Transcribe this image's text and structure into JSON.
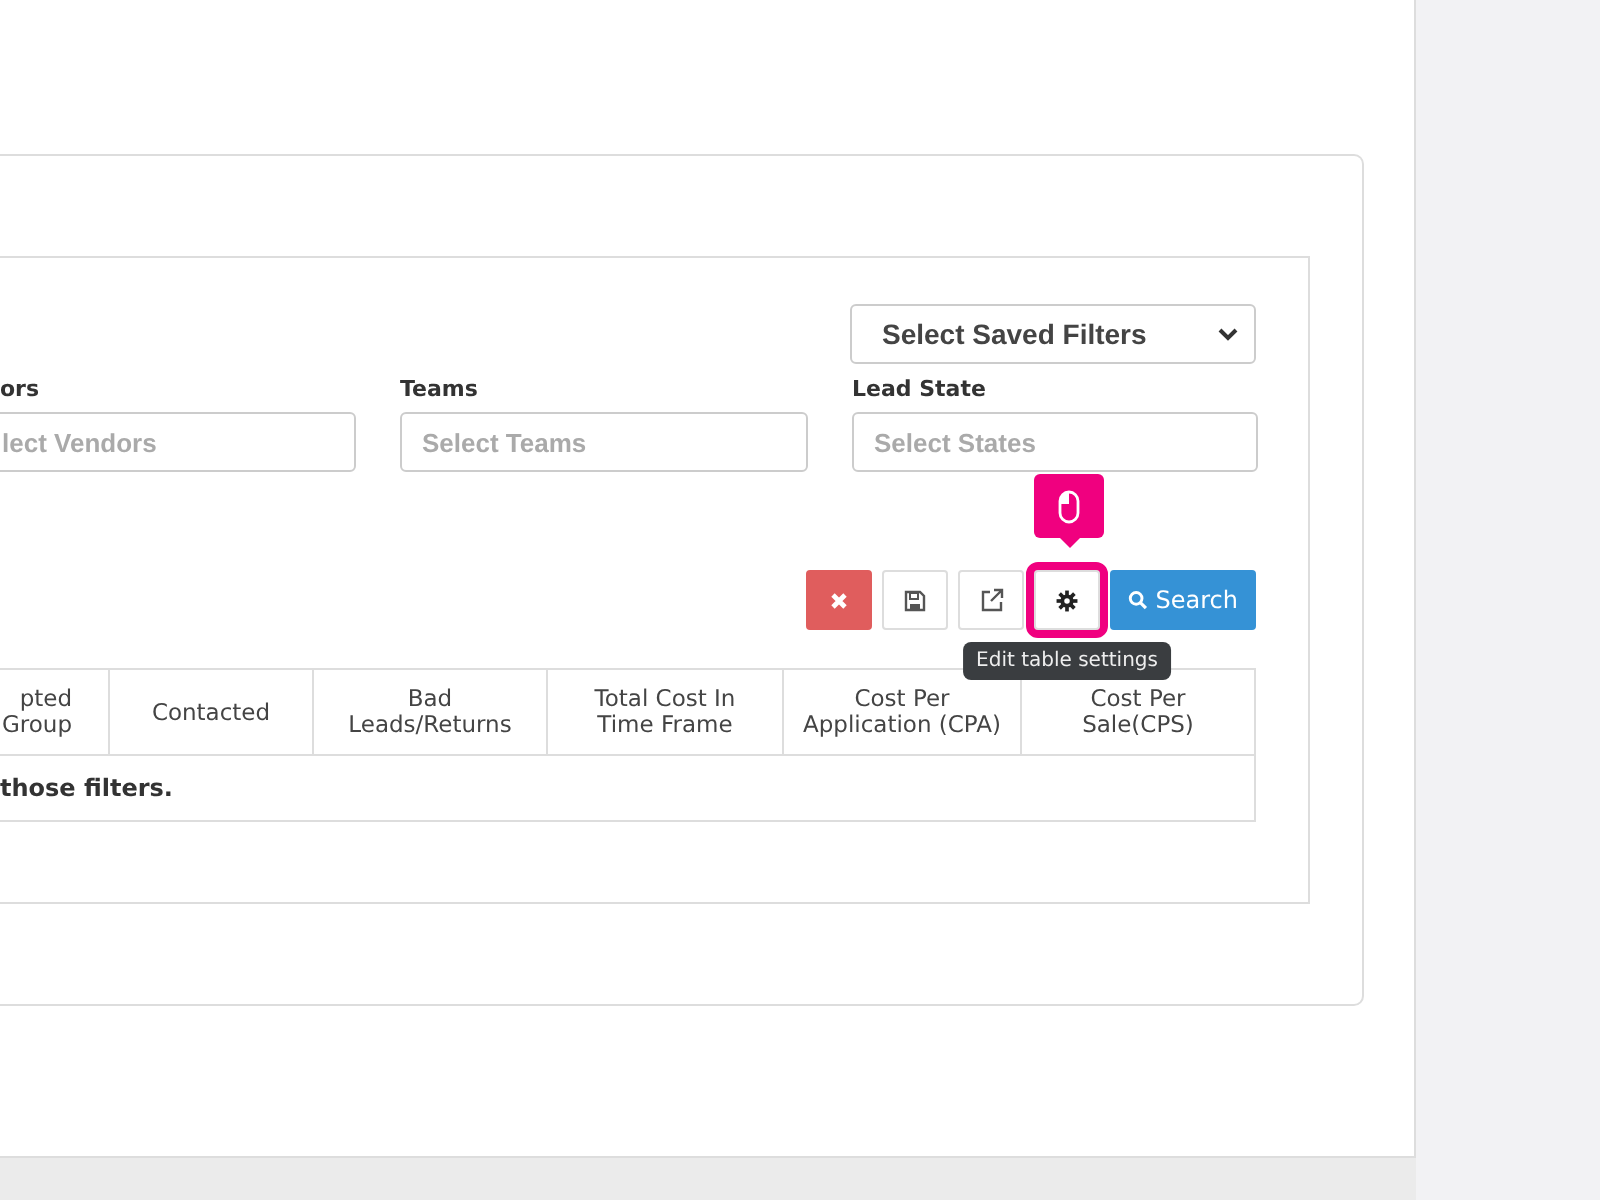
{
  "saved_filters": {
    "value": "Select Saved Filters"
  },
  "filters": [
    {
      "label": "ors",
      "placeholder": "lect Vendors"
    },
    {
      "label": "Teams",
      "placeholder": "Select Teams"
    },
    {
      "label": "Lead State",
      "placeholder": "Select States"
    }
  ],
  "actions": [
    {
      "kind": "clear",
      "highlighted": false
    },
    {
      "kind": "save",
      "highlighted": false
    },
    {
      "kind": "export",
      "highlighted": false
    },
    {
      "kind": "settings",
      "highlighted": true,
      "tooltip": "Edit table settings"
    },
    {
      "kind": "search",
      "label": "Search",
      "highlighted": false
    }
  ],
  "table": {
    "columns": [
      [
        "pted",
        "Group"
      ],
      [
        "Contacted"
      ],
      [
        "Bad",
        "Leads/Returns"
      ],
      [
        "Total Cost In",
        "Time Frame"
      ],
      [
        "Cost Per",
        "Application (CPA)"
      ],
      [
        "Cost Per",
        "Sale(CPS)"
      ]
    ],
    "empty_message": "those filters."
  }
}
